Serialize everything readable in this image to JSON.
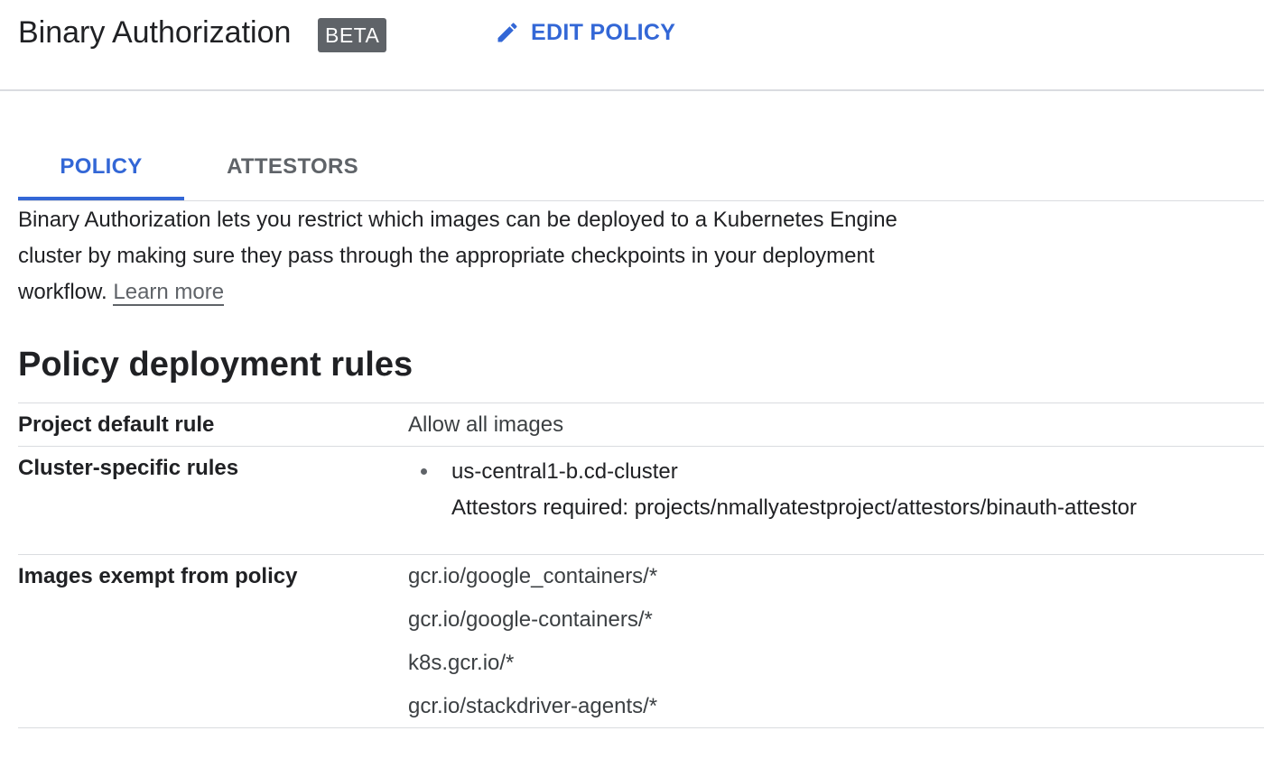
{
  "header": {
    "title": "Binary Authorization",
    "badge": "BETA",
    "edit_policy_label": "EDIT POLICY"
  },
  "tabs": [
    {
      "label": "POLICY",
      "active": true
    },
    {
      "label": "ATTESTORS",
      "active": false
    }
  ],
  "description": {
    "text": "Binary Authorization lets you restrict which images can be deployed to a Kubernetes Engine cluster by making sure they pass through the appropriate checkpoints in your deployment workflow.",
    "learn_more": "Learn more"
  },
  "rules": {
    "title": "Policy deployment rules",
    "default_rule": {
      "label": "Project default rule",
      "value": "Allow all images"
    },
    "cluster_rules": {
      "label": "Cluster-specific rules",
      "items": [
        {
          "cluster": "us-central1-b.cd-cluster",
          "attestors": "Attestors required: projects/nmallyatestproject/attestors/binauth-attestor"
        }
      ]
    },
    "exempt_images": {
      "label": "Images exempt from policy",
      "items": [
        "gcr.io/google_containers/*",
        "gcr.io/google-containers/*",
        "k8s.gcr.io/*",
        "gcr.io/stackdriver-agents/*"
      ]
    }
  },
  "colors": {
    "accent": "#3367d6",
    "badge_bg": "#5f6368",
    "divider": "#dadce0"
  },
  "icons": {
    "edit": "pencil-icon",
    "bullet": "bullet-icon"
  }
}
